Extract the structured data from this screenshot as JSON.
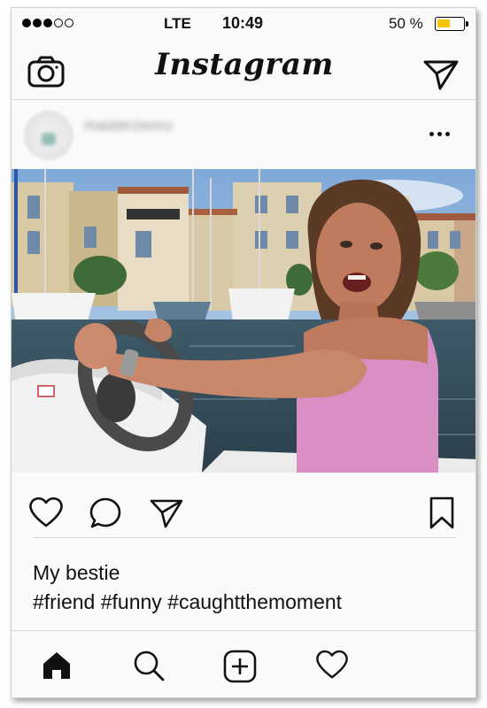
{
  "status_bar": {
    "carrier": "LTE",
    "time": "10:49",
    "battery_percent_label": "50 %",
    "battery_level": 0.5,
    "signal_bars_filled": 3,
    "signal_bars_total": 5,
    "battery_color": "#f5c400"
  },
  "nav": {
    "brand": "Instagram",
    "left_icon": "camera-icon",
    "right_icon": "direct-message-icon"
  },
  "post": {
    "username": "masterzenru",
    "more_icon": "more-options-icon",
    "caption_line1": "My bestie",
    "caption_line2": "#friend #funny #caughtthemoment"
  },
  "actions": {
    "like_icon": "heart-icon",
    "comment_icon": "comment-icon",
    "share_icon": "share-icon",
    "save_icon": "bookmark-icon"
  },
  "tab_bar": {
    "items": [
      "home-icon",
      "search-icon",
      "add-post-icon",
      "activity-heart-icon"
    ],
    "active": "home-icon"
  }
}
